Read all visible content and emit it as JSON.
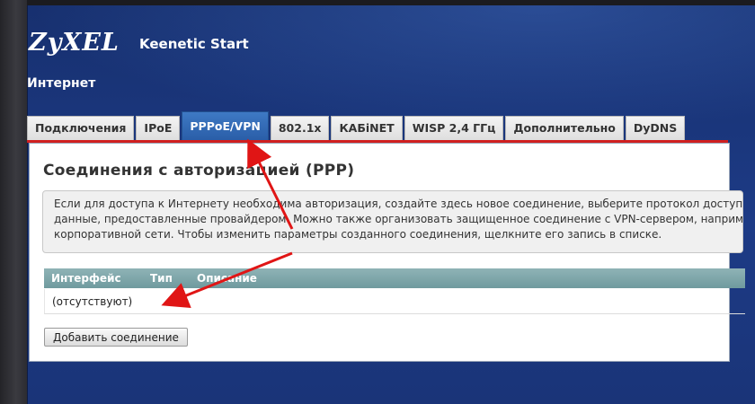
{
  "brand": {
    "logo": "ZyXEL",
    "product": "Keenetic Start"
  },
  "section": {
    "title": "Интернет"
  },
  "tabs": [
    {
      "label": "Подключения",
      "active": false
    },
    {
      "label": "IPoE",
      "active": false
    },
    {
      "label": "PPPoE/VPN",
      "active": true
    },
    {
      "label": "802.1x",
      "active": false
    },
    {
      "label": "КАБiNET",
      "active": false
    },
    {
      "label": "WISP 2,4 ГГц",
      "active": false
    },
    {
      "label": "Дополнительно",
      "active": false
    },
    {
      "label": "DyDNS",
      "active": false
    }
  ],
  "panel": {
    "title": "Соединения с авторизацией (PPP)",
    "info_lines": [
      "Если для доступа к Интернету необходима авторизация, создайте здесь новое соединение, выберите протокол доступа и у",
      "данные, предоставленные провайдером. Можно также организовать защищенное соединение с VPN-сервером, например д",
      "корпоративной сети. Чтобы изменить параметры созданного соединения, щелкните его запись в списке."
    ],
    "table": {
      "headers": [
        "Интерфейс",
        "Тип",
        "Описание"
      ],
      "empty_row": "(отсутствуют)"
    },
    "add_button": "Добавить соединение"
  },
  "colors": {
    "frame_blue": "#1d3b86",
    "active_tab": "#2f67b3",
    "accent_red": "#d01f1f",
    "table_header": "#7fa6aa"
  }
}
